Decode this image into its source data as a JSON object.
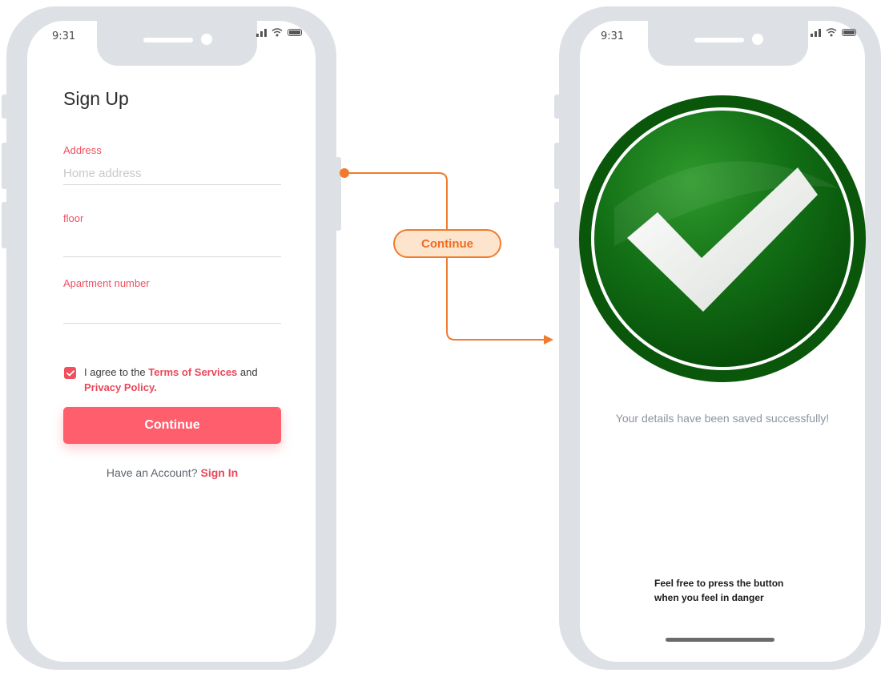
{
  "left_phone": {
    "status_time": "9:31",
    "title": "Sign Up",
    "fields": [
      {
        "label": "Address",
        "placeholder": "Home address",
        "value": ""
      },
      {
        "label": "floor",
        "placeholder": "",
        "value": ""
      },
      {
        "label": "Apartment number",
        "placeholder": "",
        "value": ""
      }
    ],
    "agreement": {
      "checked": true,
      "prefix": "I agree to the ",
      "terms_link": "Terms of Services",
      "middle": " and",
      "privacy_link": "Privacy Policy."
    },
    "continue_label": "Continue",
    "account_prompt": "Have an Account?",
    "signin_label": "Sign In"
  },
  "flow": {
    "label": "Continue"
  },
  "right_phone": {
    "status_time": "9:31",
    "success_message": "Your details have been saved successfully!",
    "note_line1": "Feel free to press the button",
    "note_line2": "when you feel in danger"
  },
  "colors": {
    "frame": "#dde0e5",
    "accent_red": "#ff5f6d",
    "label_red": "#f0505e",
    "flow_orange": "#f07b2c",
    "flow_fill": "#fde5cd",
    "success_green": "#0b6a12"
  },
  "icons": {
    "signal": "signal-icon",
    "wifi": "wifi-icon",
    "battery": "battery-icon",
    "checkbox": "checkbox-checked-icon",
    "success": "success-checkmark-icon",
    "flow_arrow": "arrow-right-icon"
  }
}
